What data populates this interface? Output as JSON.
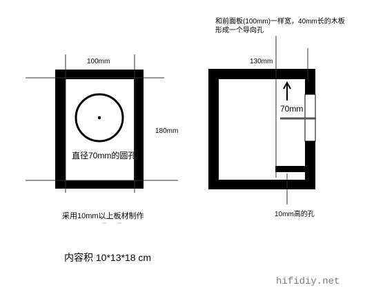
{
  "front_view": {
    "width_label": "100mm",
    "height_label": "180mm",
    "hole_label": "直径70mm的圆孔",
    "material_note": "采用10mm以上板材制作"
  },
  "side_view": {
    "width_label": "130mm",
    "port_note_line1": "和前面板(100mm)一样宽，40mm长的木板",
    "port_note_line2": "形成一个导向孔",
    "port_length_label": "70mm",
    "slot_label": "10mm高的孔"
  },
  "volume_label": "内容积 10*13*18 cm",
  "watermark": "hifidiy.net",
  "colors": {
    "ink": "#000000",
    "background": "#ffffff",
    "watermark": "#7a7a7a"
  }
}
